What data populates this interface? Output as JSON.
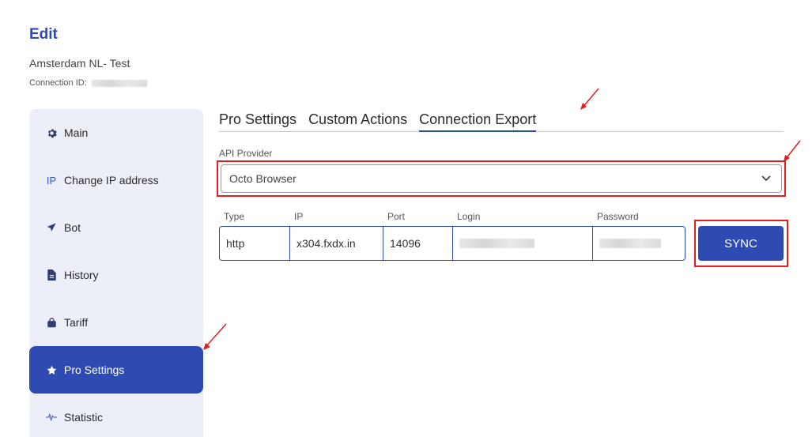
{
  "page": {
    "title": "Edit",
    "connection_name": "Amsterdam NL- Test",
    "connection_id_label": "Connection ID:"
  },
  "sidebar": {
    "items": [
      {
        "label": "Main",
        "icon": "gear-icon"
      },
      {
        "label": "Change IP address",
        "icon": "ip-icon",
        "icon_text": "IP"
      },
      {
        "label": "Bot",
        "icon": "paper-plane-icon"
      },
      {
        "label": "History",
        "icon": "document-icon"
      },
      {
        "label": "Tariff",
        "icon": "shopping-bag-icon"
      },
      {
        "label": "Pro Settings",
        "icon": "star-icon",
        "active": true
      },
      {
        "label": "Statistic",
        "icon": "pulse-icon"
      }
    ]
  },
  "tabs": [
    {
      "label": "Pro Settings"
    },
    {
      "label": "Custom Actions"
    },
    {
      "label": "Connection Export",
      "active": true
    }
  ],
  "api_provider": {
    "label": "API Provider",
    "value": "Octo Browser"
  },
  "connection": {
    "headers": {
      "type": "Type",
      "ip": "IP",
      "port": "Port",
      "login": "Login",
      "password": "Password"
    },
    "values": {
      "type": "http",
      "ip": "x304.fxdx.in",
      "port": "14096"
    }
  },
  "sync_button": {
    "label": "SYNC"
  },
  "colors": {
    "accent": "#2e4ab3",
    "sidebar_bg": "#eceff8",
    "highlight_red": "#e02020"
  }
}
